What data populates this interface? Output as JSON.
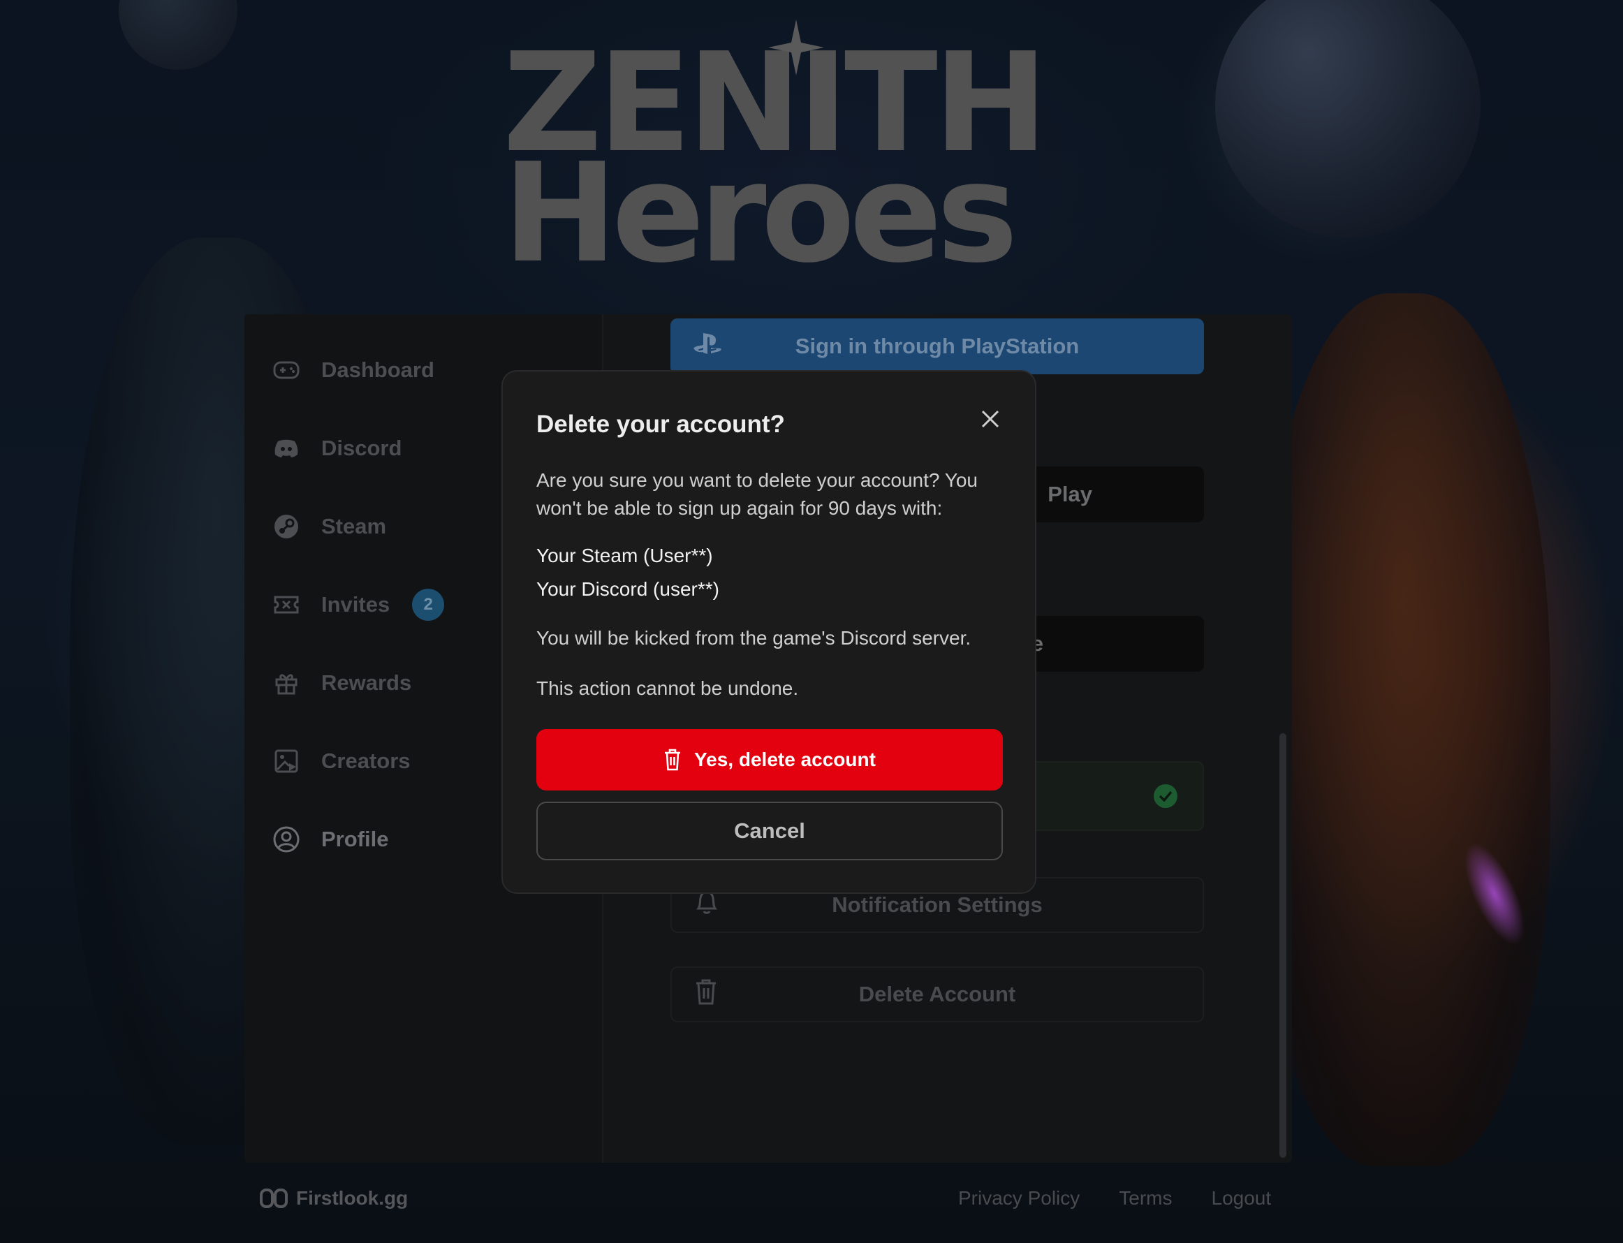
{
  "logo": {
    "line1": "ZENITH",
    "line2": "Heroes"
  },
  "sidebar": {
    "items": [
      {
        "label": "Dashboard",
        "icon": "gamepad-icon"
      },
      {
        "label": "Discord",
        "icon": "discord-icon"
      },
      {
        "label": "Steam",
        "icon": "steam-icon"
      },
      {
        "label": "Invites",
        "icon": "ticket-icon",
        "badge": "2"
      },
      {
        "label": "Rewards",
        "icon": "gift-icon"
      },
      {
        "label": "Creators",
        "icon": "creator-image-icon"
      },
      {
        "label": "Profile",
        "icon": "user-circle-icon",
        "active": true
      }
    ]
  },
  "content": {
    "psn_label": "Sign in through PlayStation",
    "play_label": "Play",
    "partial_label": "le",
    "notification_label": "Notification Settings",
    "delete_label": "Delete Account"
  },
  "footer": {
    "brand": "Firstlook.gg",
    "links": [
      "Privacy Policy",
      "Terms",
      "Logout"
    ]
  },
  "modal": {
    "title": "Delete your account?",
    "intro": "Are you sure you want to delete your account? You won't be able to sign up again for 90 days with:",
    "linked_steam": "Your Steam (User**)",
    "linked_discord": "Your Discord (user**)",
    "discord_kick": "You will be kicked from the game's Discord server.",
    "warning": "This action cannot be undone.",
    "confirm_label": "Yes, delete account",
    "cancel_label": "Cancel"
  },
  "colors": {
    "danger": "#e3000f",
    "playstation": "#1c4772",
    "badge": "#1c4e70",
    "check": "#1d5c31"
  }
}
